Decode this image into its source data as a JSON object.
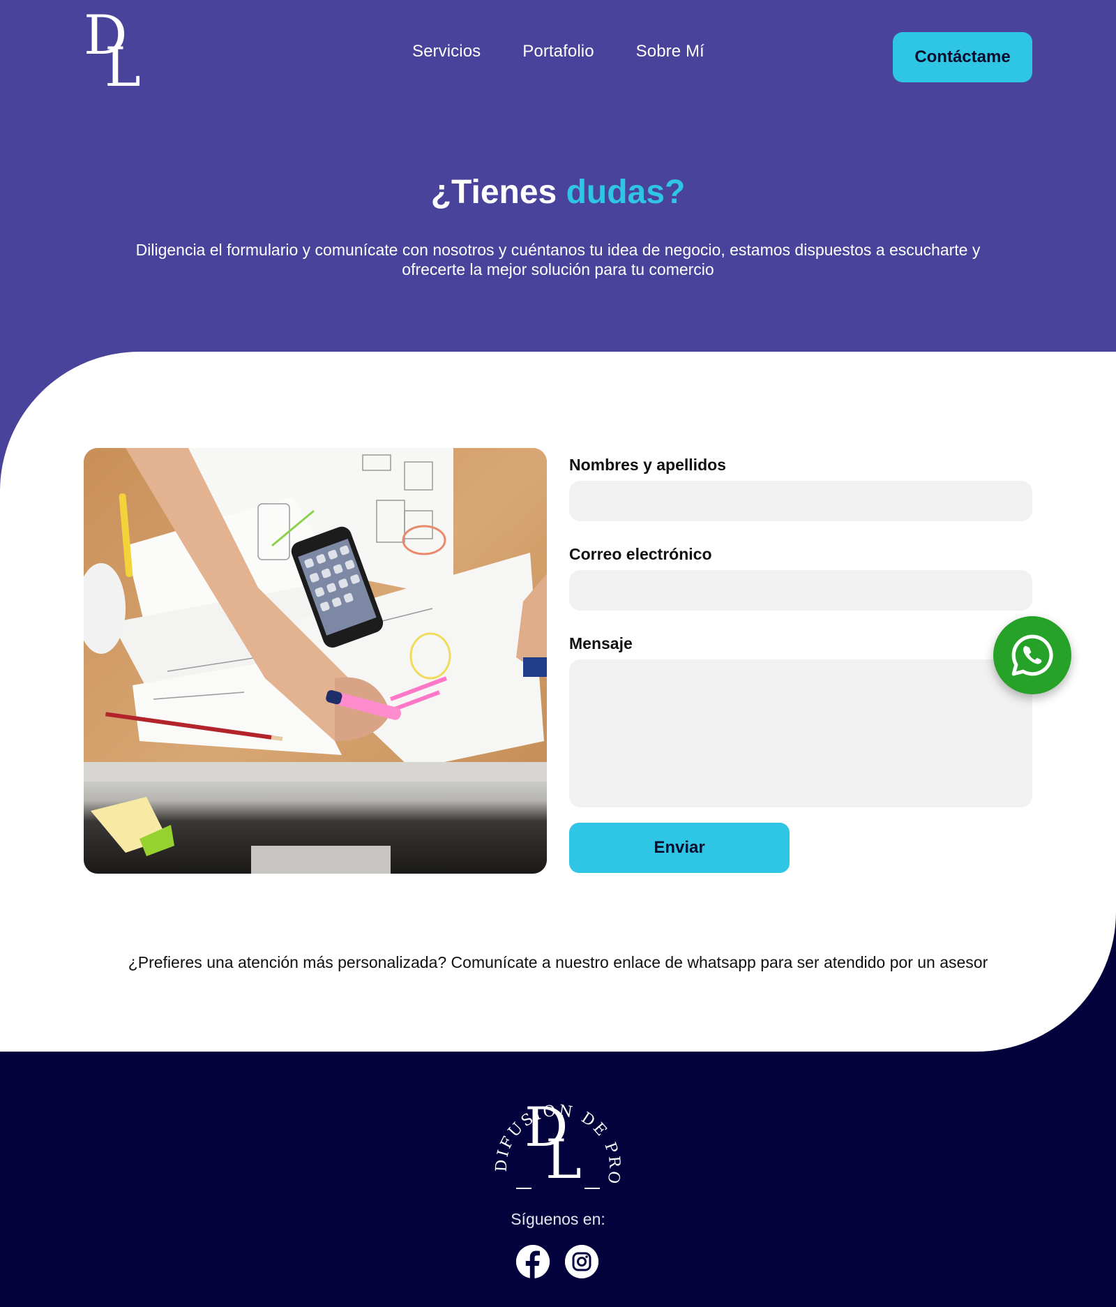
{
  "brand": {
    "logo_initials_1": "D",
    "logo_initials_2": "L",
    "seal_text": "DIFUSION DE PRODUCTOS",
    "colors": {
      "primary_purple": "#4a439b",
      "accent_cyan": "#2ec6e4",
      "footer_navy": "#03023d",
      "whatsapp_green": "#25a227"
    }
  },
  "nav": {
    "items": [
      {
        "label": "Servicios"
      },
      {
        "label": "Portafolio"
      },
      {
        "label": "Sobre Mí"
      }
    ],
    "cta_label": "Contáctame"
  },
  "hero": {
    "title_main": "¿Tienes ",
    "title_accent": "dudas?",
    "subtitle": "Diligencia el formulario y comunícate con nosotros y cuéntanos tu idea de negocio, estamos dispuestos a escucharte y ofrecerte la mejor solución para tu comercio"
  },
  "form": {
    "name_label": "Nombres y apellidos",
    "name_value": "",
    "email_label": "Correo electrónico",
    "email_value": "",
    "message_label": "Mensaje",
    "message_value": "",
    "submit_label": "Enviar"
  },
  "whatsapp": {
    "icon": "whatsapp-icon",
    "note": "¿Prefieres una atención más personalizada? Comunícate a nuestro enlace de whatsapp para ser atendido por un asesor"
  },
  "footer": {
    "follow_label": "Síguenos en:",
    "socials": [
      {
        "icon": "facebook-icon"
      },
      {
        "icon": "instagram-icon"
      }
    ]
  }
}
